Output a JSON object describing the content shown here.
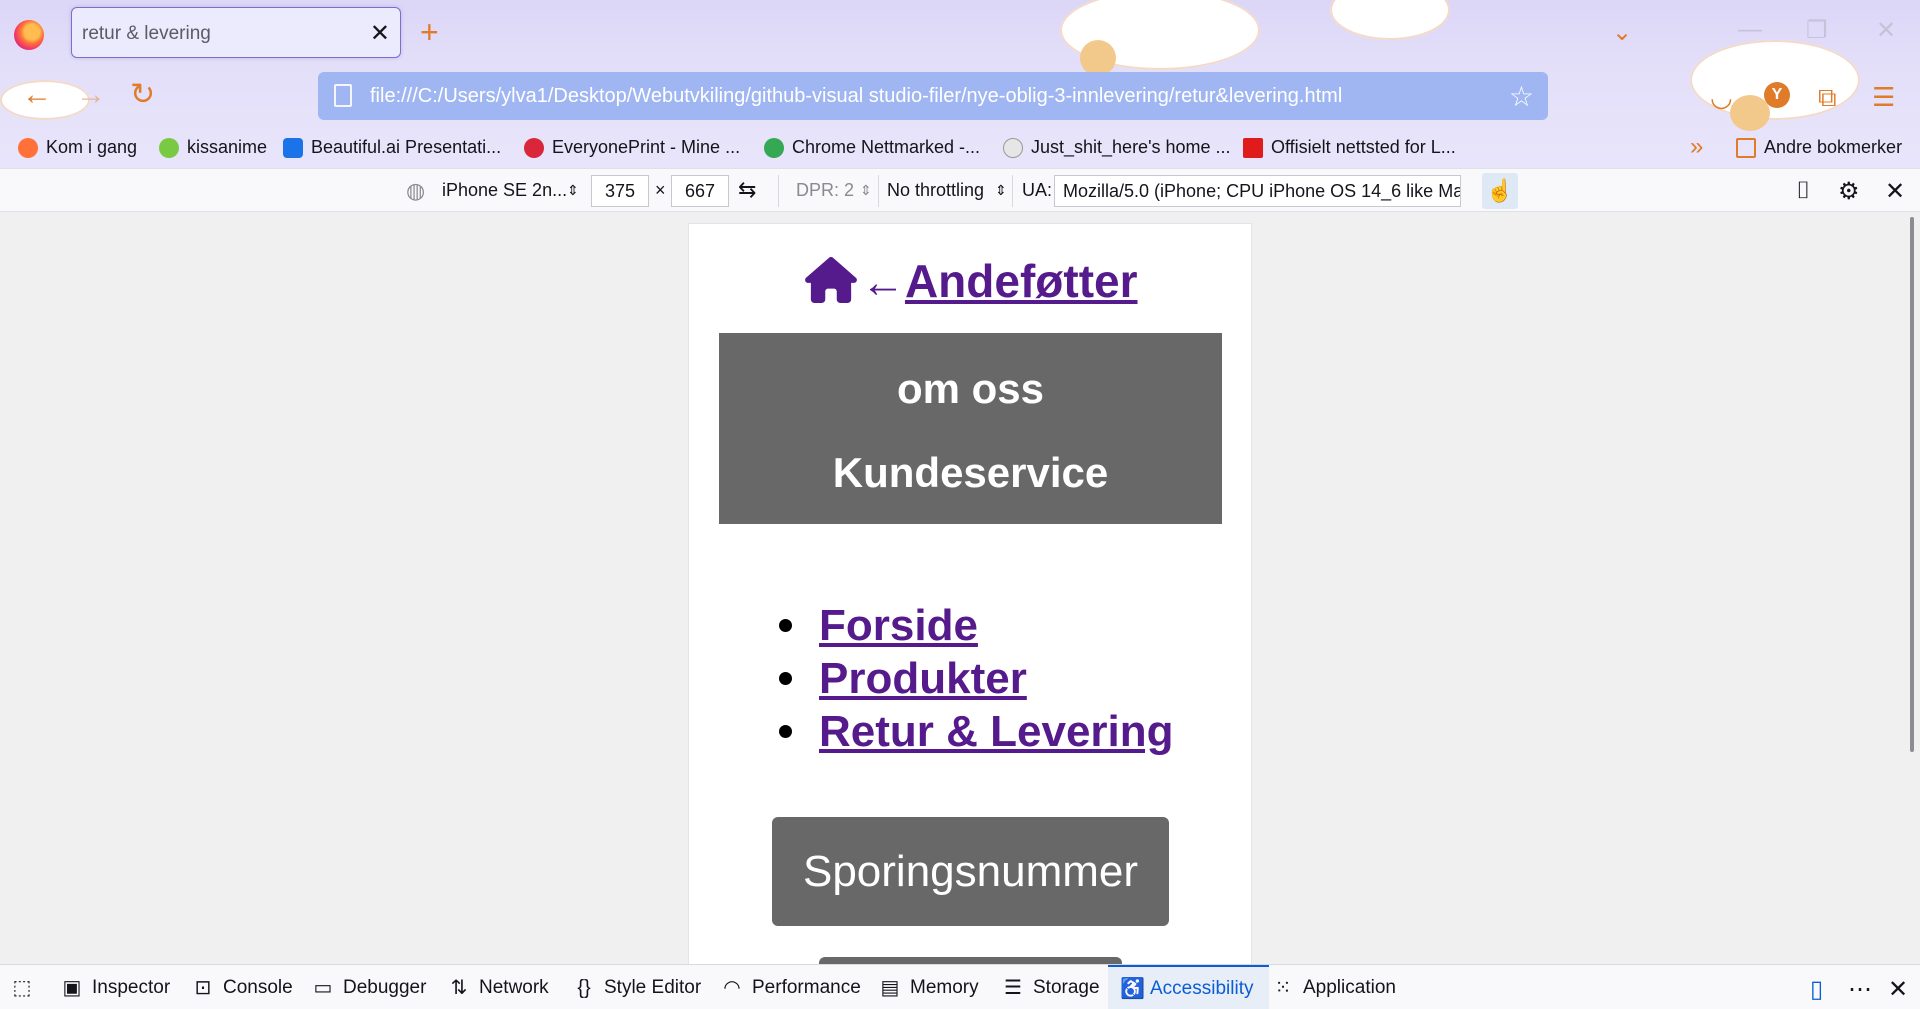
{
  "browser": {
    "tab_title": "retur & levering",
    "tab_close": "✕",
    "new_tab": "+",
    "url": "file:///C:/Users/ylva1/Desktop/Webutvkiling/github-visual studio-filer/nye-oblig-3-innlevering/retur&levering.html",
    "avatar_letter": "Y"
  },
  "bookmarks": [
    {
      "label": "Kom i gang",
      "color": "#ff7139"
    },
    {
      "label": "kissanime",
      "color": "#7ac943"
    },
    {
      "label": "Beautiful.ai Presentati...",
      "color": "#1a73e8"
    },
    {
      "label": "EveryonePrint - Mine ...",
      "color": "#d9263b"
    },
    {
      "label": "Chrome Nettmarked -...",
      "color": "#34a853"
    },
    {
      "label": "Just_shit_here's home ...",
      "color": "#e6e6e6"
    },
    {
      "label": "Offisielt nettsted for L...",
      "color": "#e01b1b"
    }
  ],
  "bookmarks_overflow": "»",
  "other_bookmarks": "Andre bokmerker",
  "rdm": {
    "device": "iPhone SE 2n...",
    "width": "375",
    "times": "×",
    "height": "667",
    "dpr": "DPR: 2",
    "throttling": "No throttling",
    "ua_label": "UA:",
    "ua_value": "Mozilla/5.0 (iPhone; CPU iPhone OS 14_6 like Mac"
  },
  "site": {
    "arrow": "←",
    "brand": "Andeføtter",
    "about": "om oss",
    "customer_service": "Kundeservice",
    "nav": [
      "Forside",
      "Produkter",
      "Retur & Levering"
    ],
    "tracking_button": "Sporingsnummer",
    "link_color": "#551a8b",
    "box_color": "#686868"
  },
  "devtools": {
    "tabs": [
      "Inspector",
      "Console",
      "Debugger",
      "Network",
      "Style Editor",
      "Performance",
      "Memory",
      "Storage",
      "Accessibility",
      "Application"
    ],
    "active_tab": "Accessibility",
    "accent": "#0b5cd5"
  }
}
